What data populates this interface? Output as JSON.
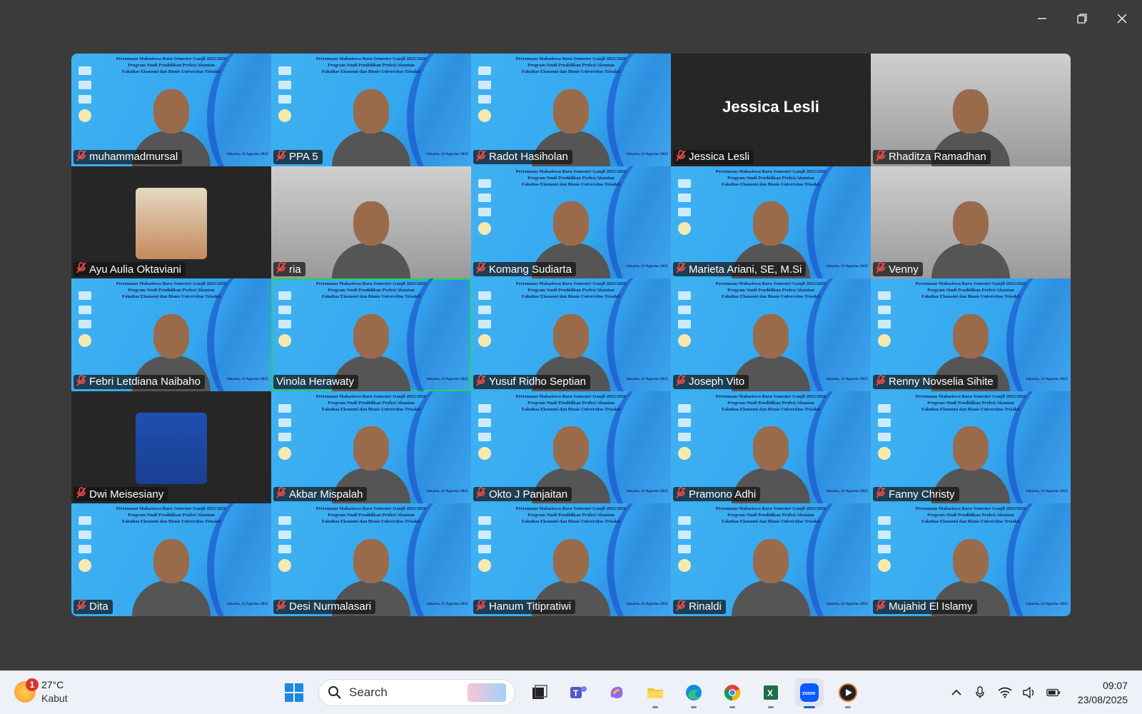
{
  "window": {
    "controls": [
      "minimize",
      "restore",
      "close"
    ]
  },
  "slide": {
    "heading_lines": [
      "Pertemuan Mahasiswa Baru Semester Ganjil 2025/2026",
      "Program Studi Pendidikan Profesi Akuntan",
      "Fakultas Ekonomi dan Bisnis Universitas Trisakti"
    ],
    "footer": "Jakarta, 23 Agustus 2025"
  },
  "participants": [
    {
      "name": "muhammadmursal",
      "view": "slide-video",
      "muted": true
    },
    {
      "name": "PPA 5",
      "view": "slide-video",
      "muted": true
    },
    {
      "name": "Radot Hasiholan",
      "view": "slide-video",
      "muted": true
    },
    {
      "name": "Jessica Lesli",
      "view": "name-only",
      "muted": true,
      "display_name": "Jessica Lesli"
    },
    {
      "name": "Rhaditza Ramadhan",
      "view": "video",
      "muted": true
    },
    {
      "name": "Ayu Aulia Oktaviani",
      "view": "avatar",
      "muted": true
    },
    {
      "name": "ria",
      "view": "video",
      "muted": true
    },
    {
      "name": "Komang Sudiarta",
      "view": "slide-video",
      "muted": true
    },
    {
      "name": "Marieta Ariani, SE, M.Si",
      "view": "slide-video",
      "muted": true
    },
    {
      "name": "Venny",
      "view": "video",
      "muted": true
    },
    {
      "name": "Febri Letdiana Naibaho",
      "view": "slide-video",
      "muted": true
    },
    {
      "name": "Vinola Herawaty",
      "view": "slide-video",
      "muted": false,
      "active_speaker": true
    },
    {
      "name": "Yusuf Ridho Septian",
      "view": "slide-video",
      "muted": true
    },
    {
      "name": "Joseph Vito",
      "view": "slide-video",
      "muted": true
    },
    {
      "name": "Renny Novselia Sihite",
      "view": "slide-video",
      "muted": true
    },
    {
      "name": "Dwi Meisesiany",
      "view": "avatar",
      "muted": true
    },
    {
      "name": "Akbar Mispalah",
      "view": "slide-video",
      "muted": true
    },
    {
      "name": "Okto J Panjaitan",
      "view": "slide-video",
      "muted": true
    },
    {
      "name": "Pramono Adhi",
      "view": "slide-video",
      "muted": true
    },
    {
      "name": "Fanny Christy",
      "view": "slide-video",
      "muted": true
    },
    {
      "name": "Dita",
      "view": "slide-video",
      "muted": true
    },
    {
      "name": "Desi Nurmalasari",
      "view": "slide-video",
      "muted": true
    },
    {
      "name": "Hanum Titipratiwi",
      "view": "slide-video",
      "muted": true
    },
    {
      "name": "Rinaldi",
      "view": "slide-video",
      "muted": true
    },
    {
      "name": "Mujahid El Islamy",
      "view": "slide-video",
      "muted": true
    }
  ],
  "taskbar": {
    "weather": {
      "temp": "27°C",
      "condition": "Kabut",
      "badge": "1"
    },
    "search_placeholder": "Search",
    "pinned": [
      "windows-start",
      "search",
      "task-view",
      "teams",
      "copilot",
      "file-explorer",
      "edge",
      "chrome",
      "excel",
      "zoom",
      "media-player"
    ],
    "active_app": "zoom",
    "tray": [
      "chevron-up",
      "mic",
      "wifi",
      "volume",
      "battery"
    ],
    "time": "09:07",
    "date": "23/08/2025"
  },
  "colors": {
    "slide_bg": "#3fb2f3",
    "active_speaker_border": "#23d160",
    "taskbar_bg": "#eef1f8",
    "window_bg": "#3b3b3b"
  }
}
